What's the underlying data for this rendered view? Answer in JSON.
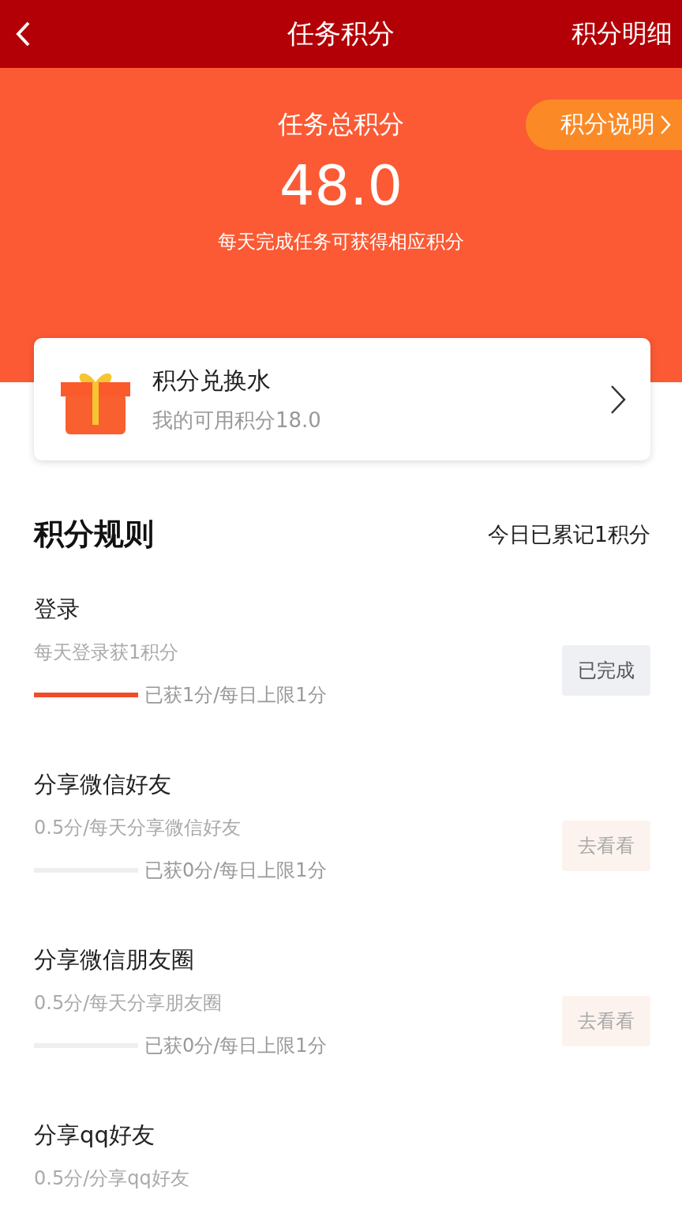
{
  "nav": {
    "title": "任务积分",
    "action": "积分明细"
  },
  "hero": {
    "label": "任务总积分",
    "total": "48.0",
    "hint": "每天完成任务可获得相应积分",
    "explain": "积分说明"
  },
  "exchange": {
    "title": "积分兑换水",
    "subtitle": "我的可用积分18.0"
  },
  "rules": {
    "title": "积分规则",
    "today": "今日已累记1积分"
  },
  "tasks": [
    {
      "title": "登录",
      "desc": "每天登录获1积分",
      "level": 1,
      "progress": "已获1分/每日上限1分",
      "button": "已完成",
      "completed": true
    },
    {
      "title": "分享微信好友",
      "desc": "0.5分/每天分享微信好友",
      "level": 0,
      "progress": "已获0分/每日上限1分",
      "button": "去看看",
      "completed": false
    },
    {
      "title": "分享微信朋友圈",
      "desc": "0.5分/每天分享朋友圈",
      "level": 0,
      "progress": "已获0分/每日上限1分",
      "button": "去看看",
      "completed": false
    },
    {
      "title": "分享qq好友",
      "desc": "0.5分/分享qq好友"
    }
  ]
}
